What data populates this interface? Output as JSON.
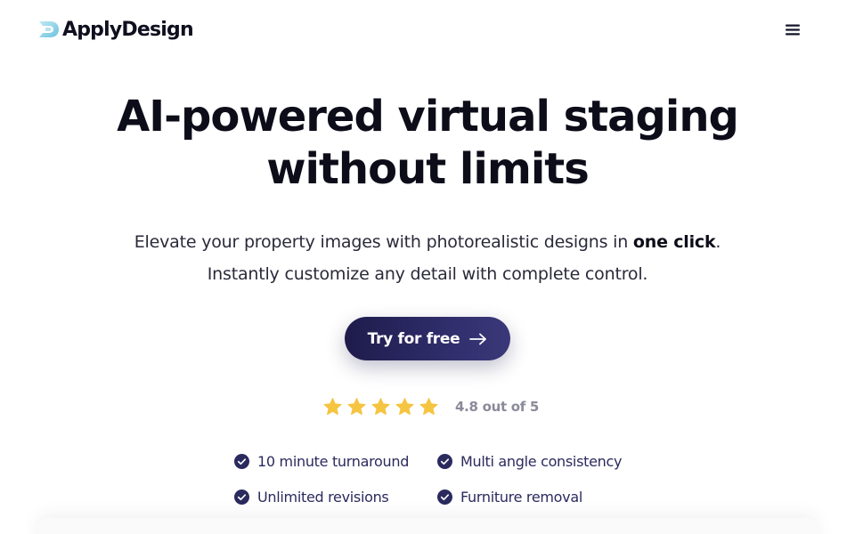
{
  "header": {
    "logo_text": "ApplyDesign",
    "menu_icon": "hamburger-menu-icon"
  },
  "hero": {
    "title_line1": "AI-powered virtual staging",
    "title_line2": "without limits",
    "subtitle_line1_before": "Elevate your property images with photorealistic designs in ",
    "subtitle_line1_bold": "one click",
    "subtitle_line1_after": ".",
    "subtitle_line2": "Instantly customize any detail with complete control."
  },
  "cta": {
    "label": "Try for free",
    "icon": "arrow-right-icon"
  },
  "rating": {
    "stars": 5,
    "value": 4.8,
    "text": "4.8 out of 5"
  },
  "features": [
    {
      "label": "10 minute turnaround"
    },
    {
      "label": "Multi angle consistency"
    },
    {
      "label": "Unlimited revisions"
    },
    {
      "label": "Furniture removal"
    }
  ],
  "colors": {
    "brand_dark": "#1e1b4b",
    "star": "#f5c542",
    "check": "#2b2a5e",
    "logo_accent": "#8fd3e8"
  }
}
